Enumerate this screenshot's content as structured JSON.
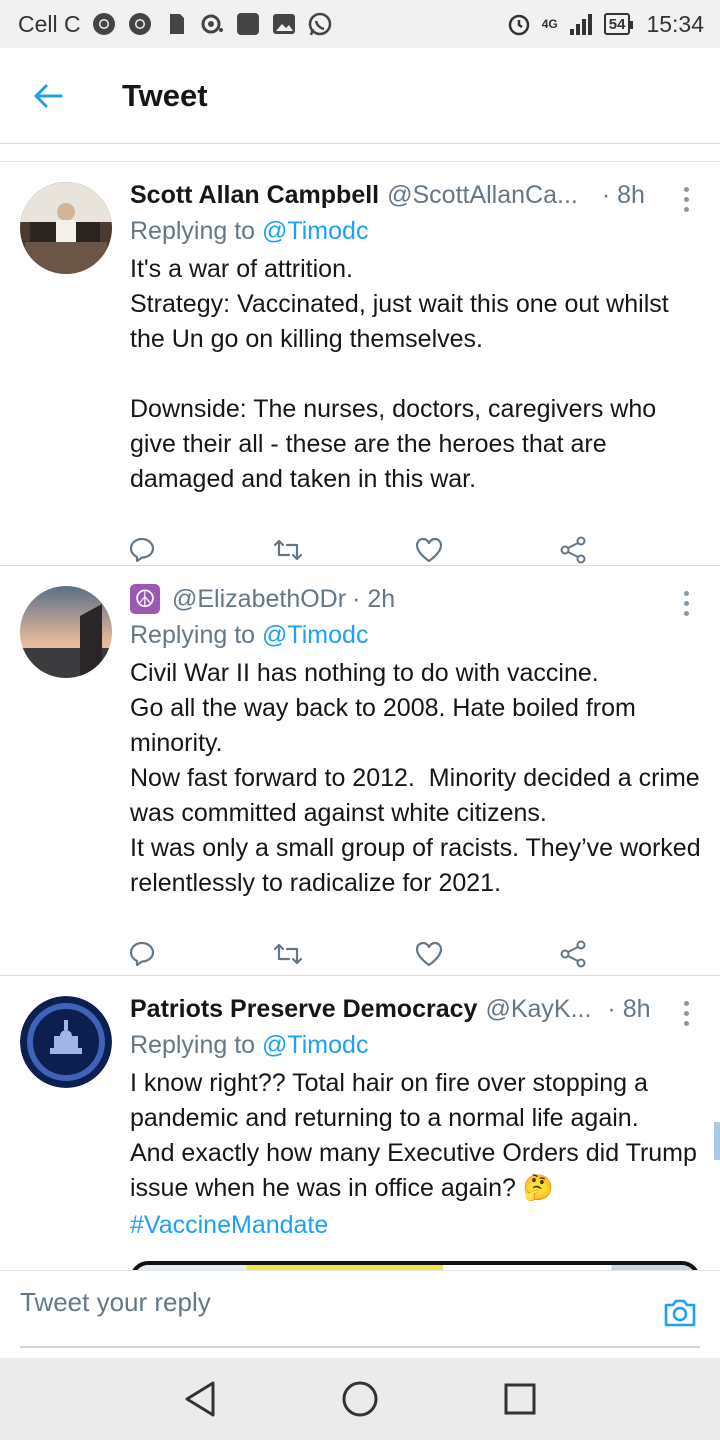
{
  "status_bar": {
    "carrier": "Cell C",
    "network": "4G",
    "battery": "54",
    "time": "15:34"
  },
  "header": {
    "title": "Tweet"
  },
  "tweets": [
    {
      "name": "Scott Allan Campbell",
      "handle": "@ScottAllanCa...",
      "time": "· 8h",
      "replying_prefix": "Replying to ",
      "replying_to": "@Timodc",
      "text": "It's a war of attrition.\nStrategy: Vaccinated, just wait this one out whilst the Un go on killing themselves.\n\nDownside: The nurses, doctors, caregivers who give their all - these are the heroes that are damaged and taken in this war."
    },
    {
      "name": "☮",
      "handle": "@ElizabethODr",
      "time": "· 2h",
      "replying_prefix": "Replying to ",
      "replying_to": "@Timodc",
      "text": "Civil War II has nothing to do with vaccine.\nGo all the way back to 2008. Hate boiled from minority.\nNow fast forward to 2012.  Minority decided a crime was committed against white citizens.\nIt was only a small group of racists. They’ve worked relentlessly to radicalize for 2021."
    },
    {
      "name": "Patriots Preserve Democracy",
      "handle": "@KayK...",
      "time": "· 8h",
      "replying_prefix": "Replying to ",
      "replying_to": "@Timodc",
      "text": "I know right?? Total hair on fire over stopping a pandemic and returning to a normal life again.\nAnd exactly how many Executive Orders did Trump issue when he was in office again? 🤔",
      "hashtag": "#VaccineMandate"
    }
  ],
  "reply_bar": {
    "placeholder": "Tweet your reply"
  },
  "icons": {
    "back": "arrow-left-icon",
    "reply": "comment-icon",
    "retweet": "retweet-icon",
    "like": "heart-icon",
    "share": "share-icon",
    "more": "more-vertical-icon",
    "camera": "camera-icon"
  },
  "colors": {
    "accent": "#1da1f2",
    "secondary_text": "#657786",
    "primary_text": "#14171a"
  }
}
